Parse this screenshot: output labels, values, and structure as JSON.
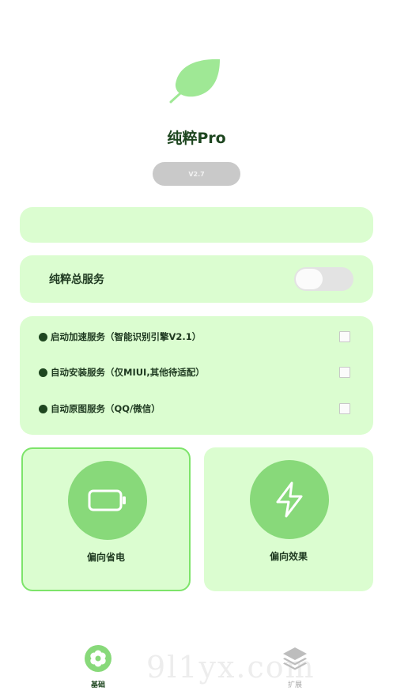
{
  "app": {
    "title": "纯粹Pro",
    "version": "V2.7"
  },
  "service": {
    "label": "纯粹总服务",
    "enabled": false
  },
  "options": [
    {
      "label": "启动加速服务（智能识别引擎V2.1）",
      "checked": false
    },
    {
      "label": "自动安装服务（仅MIUI,其他待适配）",
      "checked": false
    },
    {
      "label": "自动原图服务（QQ/微信）",
      "checked": false
    }
  ],
  "modes": {
    "power_saving": {
      "label": "偏向省电",
      "icon": "battery-icon",
      "selected": true
    },
    "performance": {
      "label": "偏向效果",
      "icon": "lightning-icon",
      "selected": false
    }
  },
  "nav": {
    "basic": {
      "label": "基础",
      "icon": "flower-icon",
      "active": true
    },
    "extend": {
      "label": "扩展",
      "icon": "layers-icon",
      "active": false
    }
  },
  "watermark": "9l1yx.com",
  "colors": {
    "card_bg": "#dbfdd0",
    "accent_green": "#88d97a",
    "selected_border": "#7de46a",
    "title_dark_green": "#1e4620"
  }
}
